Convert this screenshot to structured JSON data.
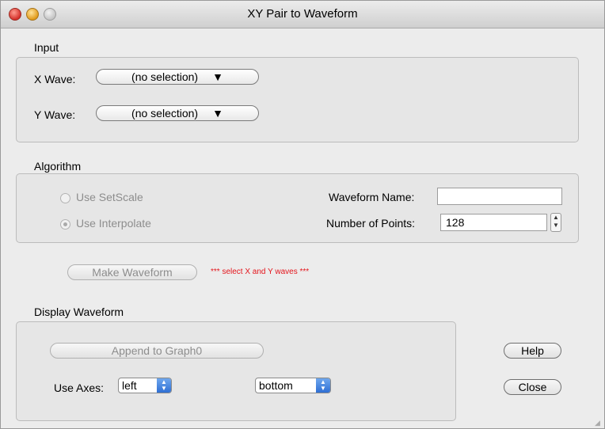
{
  "window": {
    "title": "XY Pair to Waveform"
  },
  "input": {
    "heading": "Input",
    "x_wave_label": "X Wave:",
    "x_wave_value": "(no selection)",
    "y_wave_label": "Y Wave:",
    "y_wave_value": "(no selection)",
    "popup_arrow": "▼"
  },
  "algorithm": {
    "heading": "Algorithm",
    "use_setscale_label": "Use SetScale",
    "use_interpolate_label": "Use Interpolate",
    "waveform_name_label": "Waveform Name:",
    "waveform_name_value": "",
    "number_of_points_label": "Number of Points:",
    "number_of_points_value": "128"
  },
  "actions": {
    "make_waveform_label": "Make Waveform",
    "warning": "*** select X and Y waves ***"
  },
  "display": {
    "heading": "Display Waveform",
    "append_label": "Append to Graph0",
    "use_axes_label": "Use Axes:",
    "vertical_axis_value": "left",
    "horizontal_axis_value": "bottom"
  },
  "buttons": {
    "help_label": "Help",
    "close_label": "Close"
  },
  "colors": {
    "warning": "#e4141b",
    "window_bg": "#ececec"
  }
}
